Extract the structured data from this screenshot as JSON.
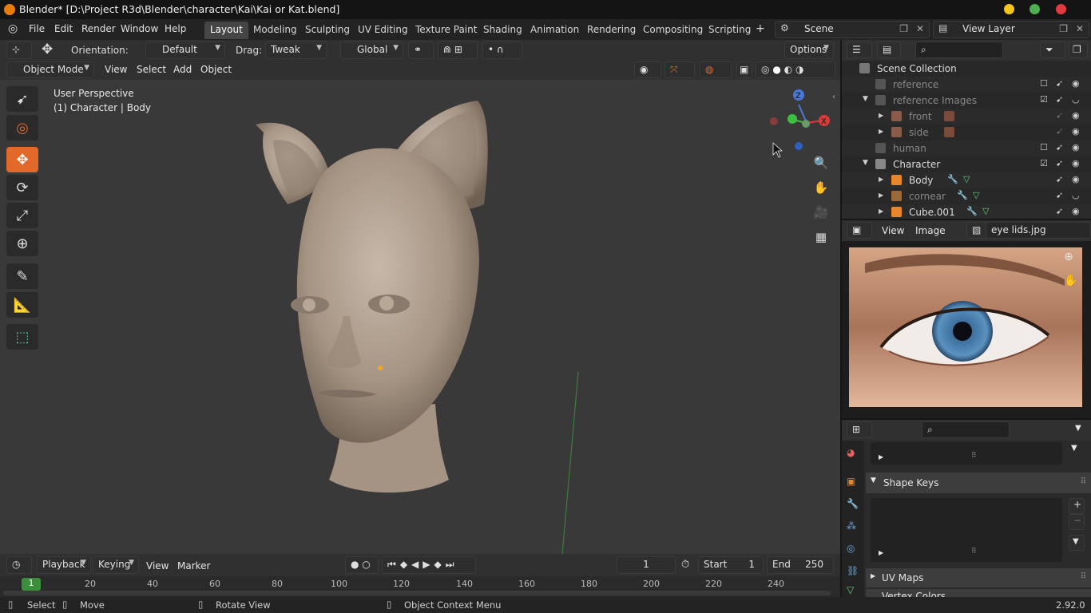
{
  "window": {
    "title": "Blender* [D:\\Project R3d\\Blender\\character\\Kai\\Kai or Kat.blend]",
    "colors": {
      "min": "#f5c518",
      "max": "#4caf50",
      "close": "#e0393e"
    }
  },
  "menubar": {
    "menus": [
      "File",
      "Edit",
      "Render",
      "Window",
      "Help"
    ],
    "workspaces": [
      "Layout",
      "Modeling",
      "Sculpting",
      "UV Editing",
      "Texture Paint",
      "Shading",
      "Animation",
      "Rendering",
      "Compositing",
      "Scripting"
    ],
    "active_workspace": "Layout",
    "add_tab": "+",
    "scene": "Scene",
    "view_layer": "View Layer"
  },
  "tool_header": {
    "orientation_label": "Orientation:",
    "orientation_value": "Default",
    "drag_label": "Drag:",
    "drag_value": "Tweak",
    "transform_orientation": "Global",
    "options": "Options"
  },
  "viewport_header": {
    "mode": "Object Mode",
    "menus": [
      "View",
      "Select",
      "Add",
      "Object"
    ]
  },
  "viewport": {
    "perspective": "User Perspective",
    "active_object": "(1) Character | Body",
    "gizmo": {
      "x": "X",
      "y": "Y",
      "z": "Z"
    },
    "tools": [
      "cursor",
      "select",
      "move",
      "rotate",
      "scale",
      "transform",
      "annotate",
      "measure",
      "add-cube"
    ],
    "active_tool": "move"
  },
  "outliner": {
    "root": "Scene Collection",
    "rows": [
      {
        "label": "reference",
        "dim": true,
        "checked": false
      },
      {
        "label": "reference Images",
        "dim": true,
        "checked": true
      },
      {
        "label": "front",
        "dim": true
      },
      {
        "label": "side",
        "dim": true
      },
      {
        "label": "human",
        "dim": true,
        "checked": false
      },
      {
        "label": "Character",
        "dim": false,
        "checked": true
      },
      {
        "label": "Body",
        "dim": false
      },
      {
        "label": "cornear",
        "dim": true
      },
      {
        "label": "Cube.001",
        "dim": false
      }
    ]
  },
  "image_editor": {
    "menus": [
      "View",
      "Image"
    ],
    "image_name": "eye lids.jpg"
  },
  "properties": {
    "sections": [
      "Shape Keys",
      "UV Maps",
      "Vertex Colors"
    ],
    "add": "+",
    "remove": "−"
  },
  "timeline": {
    "menus": [
      "Playback",
      "Keying",
      "View",
      "Marker"
    ],
    "current_frame": "1",
    "start_label": "Start",
    "start_value": "1",
    "end_label": "End",
    "end_value": "250",
    "ruler": [
      "1",
      "20",
      "40",
      "60",
      "80",
      "100",
      "120",
      "140",
      "160",
      "180",
      "200",
      "220",
      "240"
    ]
  },
  "statusbar": {
    "select": "Select",
    "move": "Move",
    "rotate": "Rotate View",
    "context": "Object Context Menu",
    "version": "2.92.0"
  }
}
